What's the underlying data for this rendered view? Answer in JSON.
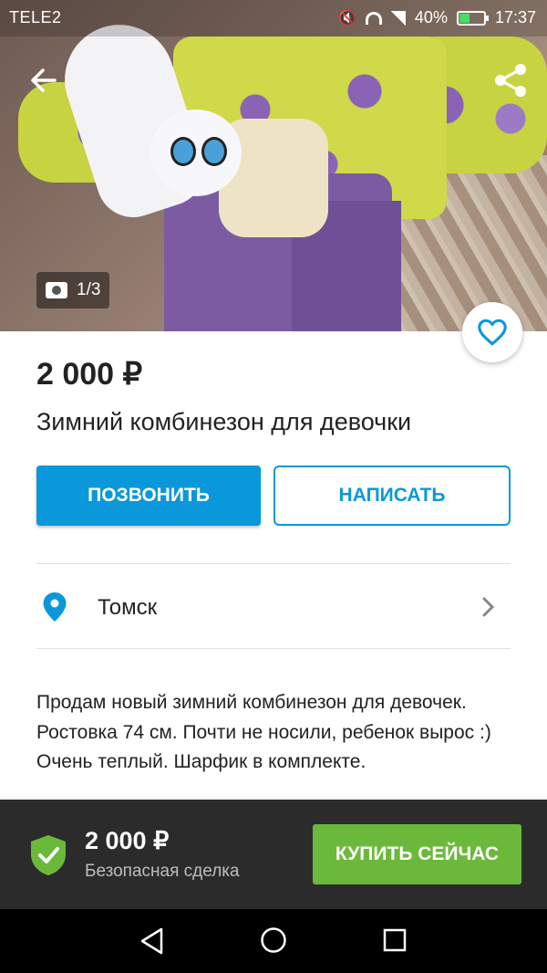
{
  "status_bar": {
    "carrier": "TELE2",
    "battery": "40%",
    "time": "17:37"
  },
  "gallery": {
    "counter": "1/3"
  },
  "listing": {
    "price": "2 000 ₽",
    "title": "Зимний комбинезон для девочки"
  },
  "actions": {
    "call_label": "ПОЗВОНИТЬ",
    "write_label": "НАПИСАТЬ"
  },
  "location": {
    "city": "Томск"
  },
  "description": "Продам новый зимний комбинезон для девочек. Ростовка 74 см. Почти не носили, ребенок вырос :) Очень теплый. Шарфик в комплекте.",
  "purchase_bar": {
    "price": "2 000 ₽",
    "safe_deal": "Безопасная сделка",
    "buy_label": "КУПИТЬ СЕЙЧАС"
  },
  "colors": {
    "primary": "#0a98db",
    "buy_green": "#6bb93a"
  },
  "icons": [
    "back-arrow-icon",
    "share-icon",
    "camera-icon",
    "heart-icon",
    "location-pin-icon",
    "chevron-right-icon",
    "shield-check-icon",
    "nav-back-icon",
    "nav-home-icon",
    "nav-recent-icon"
  ]
}
